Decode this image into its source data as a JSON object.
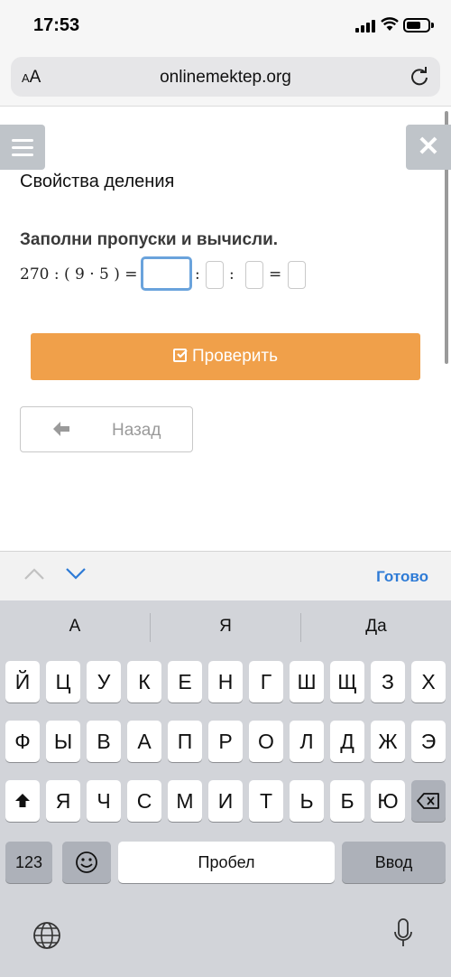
{
  "status": {
    "time": "17:53"
  },
  "browser": {
    "aa": "AA",
    "url": "onlinemektep.org"
  },
  "page": {
    "title": "Свойства деления",
    "instruction": "Заполни пропуски и вычисли.",
    "expression": "270 : ( 9 · 5 ) =",
    "colon": ":",
    "equals": "=",
    "check_label": "Проверить",
    "back_label": "Назад"
  },
  "accessory": {
    "done_label": "Готово"
  },
  "keyboard": {
    "suggestions": [
      "А",
      "Я",
      "Да"
    ],
    "row1": [
      "Й",
      "Ц",
      "У",
      "К",
      "Е",
      "Н",
      "Г",
      "Ш",
      "Щ",
      "З",
      "Х"
    ],
    "row2": [
      "Ф",
      "Ы",
      "В",
      "А",
      "П",
      "Р",
      "О",
      "Л",
      "Д",
      "Ж",
      "Э"
    ],
    "row3": [
      "Я",
      "Ч",
      "С",
      "М",
      "И",
      "Т",
      "Ь",
      "Б",
      "Ю"
    ],
    "numbers_label": "123",
    "space_label": "Пробел",
    "return_label": "Ввод"
  },
  "colors": {
    "accent": "#f0a04a",
    "link": "#2e7bd6",
    "focus": "#6aa3dc"
  }
}
